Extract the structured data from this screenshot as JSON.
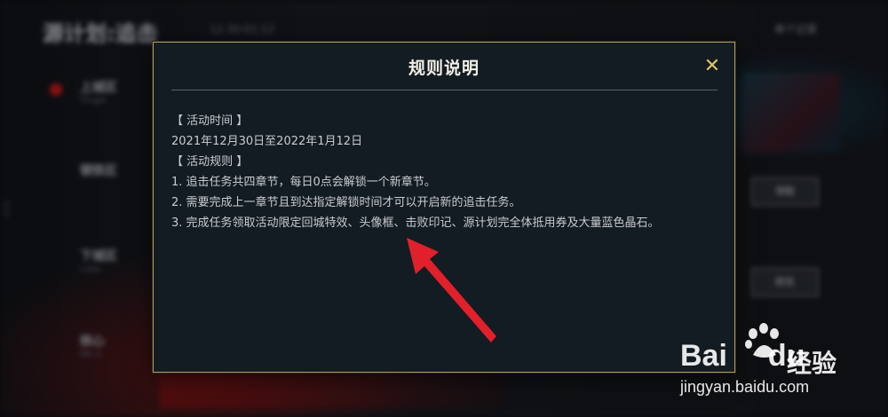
{
  "background": {
    "title": "源计划:追击",
    "date_range": "12.30-01.12",
    "top_right": "单个记录",
    "side_items": [
      {
        "title": "上城区",
        "subtitle": "Tingle"
      },
      {
        "title": "钢铁区",
        "subtitle": ""
      },
      {
        "title": "下城区",
        "subtitle": "Labs"
      },
      {
        "title": "核心",
        "subtitle": "Mk.II"
      }
    ],
    "buttons": [
      "领取",
      "前往"
    ],
    "vertical_text": "6025"
  },
  "dialog": {
    "title": "规则说明",
    "close_glyph": "✕",
    "lines": [
      "【 活动时间 】",
      "2021年12月30日至2022年1月12日",
      "【 活动规则 】",
      "1. 追击任务共四章节，每日0点会解锁一个新章节。",
      "2. 需要完成上一章节且到达指定解锁时间才可以开启新的追击任务。",
      "3. 完成任务领取活动限定回城特效、头像框、击败印记、源计划完全体抵用券及大量蓝色晶石。"
    ]
  },
  "annotation": {
    "arrow_color": "#e0202a",
    "icon": "red-arrow-icon"
  },
  "watermark": {
    "logo": "Bai",
    "logo_suffix": "du",
    "cn": "经验",
    "url": "jingyan.baidu.com"
  },
  "colors": {
    "accent_gold": "#b49a5c",
    "close_gold": "#e1c16a",
    "dialog_bg": "#131c22"
  }
}
